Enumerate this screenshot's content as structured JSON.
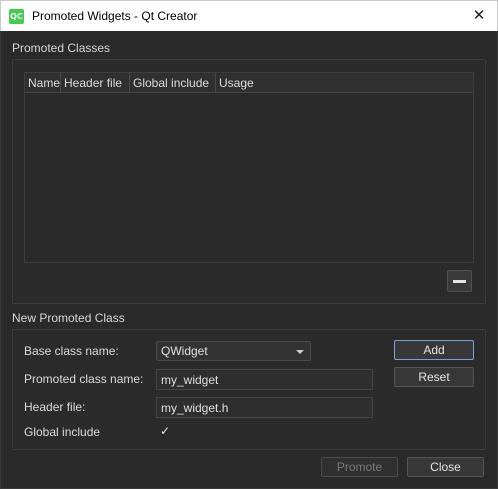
{
  "window": {
    "app_icon_text": "QC",
    "title": "Promoted Widgets - Qt Creator",
    "close_glyph": "✕"
  },
  "promoted_classes": {
    "section_label": "Promoted Classes",
    "columns": [
      "Name",
      "Header file",
      "Global include",
      "Usage"
    ],
    "rows": [],
    "remove_button_icon": "minus-icon"
  },
  "new_promoted_class": {
    "section_label": "New Promoted Class",
    "base_class_label": "Base class name:",
    "base_class_value": "QWidget",
    "promoted_class_label": "Promoted class name:",
    "promoted_class_value": "my_widget",
    "header_file_label": "Header file:",
    "header_file_value": "my_widget.h",
    "global_include_label": "Global include",
    "global_include_checked": true,
    "check_glyph": "✓",
    "add_label": "Add",
    "reset_label": "Reset"
  },
  "footer": {
    "promote_label": "Promote",
    "close_label": "Close"
  }
}
